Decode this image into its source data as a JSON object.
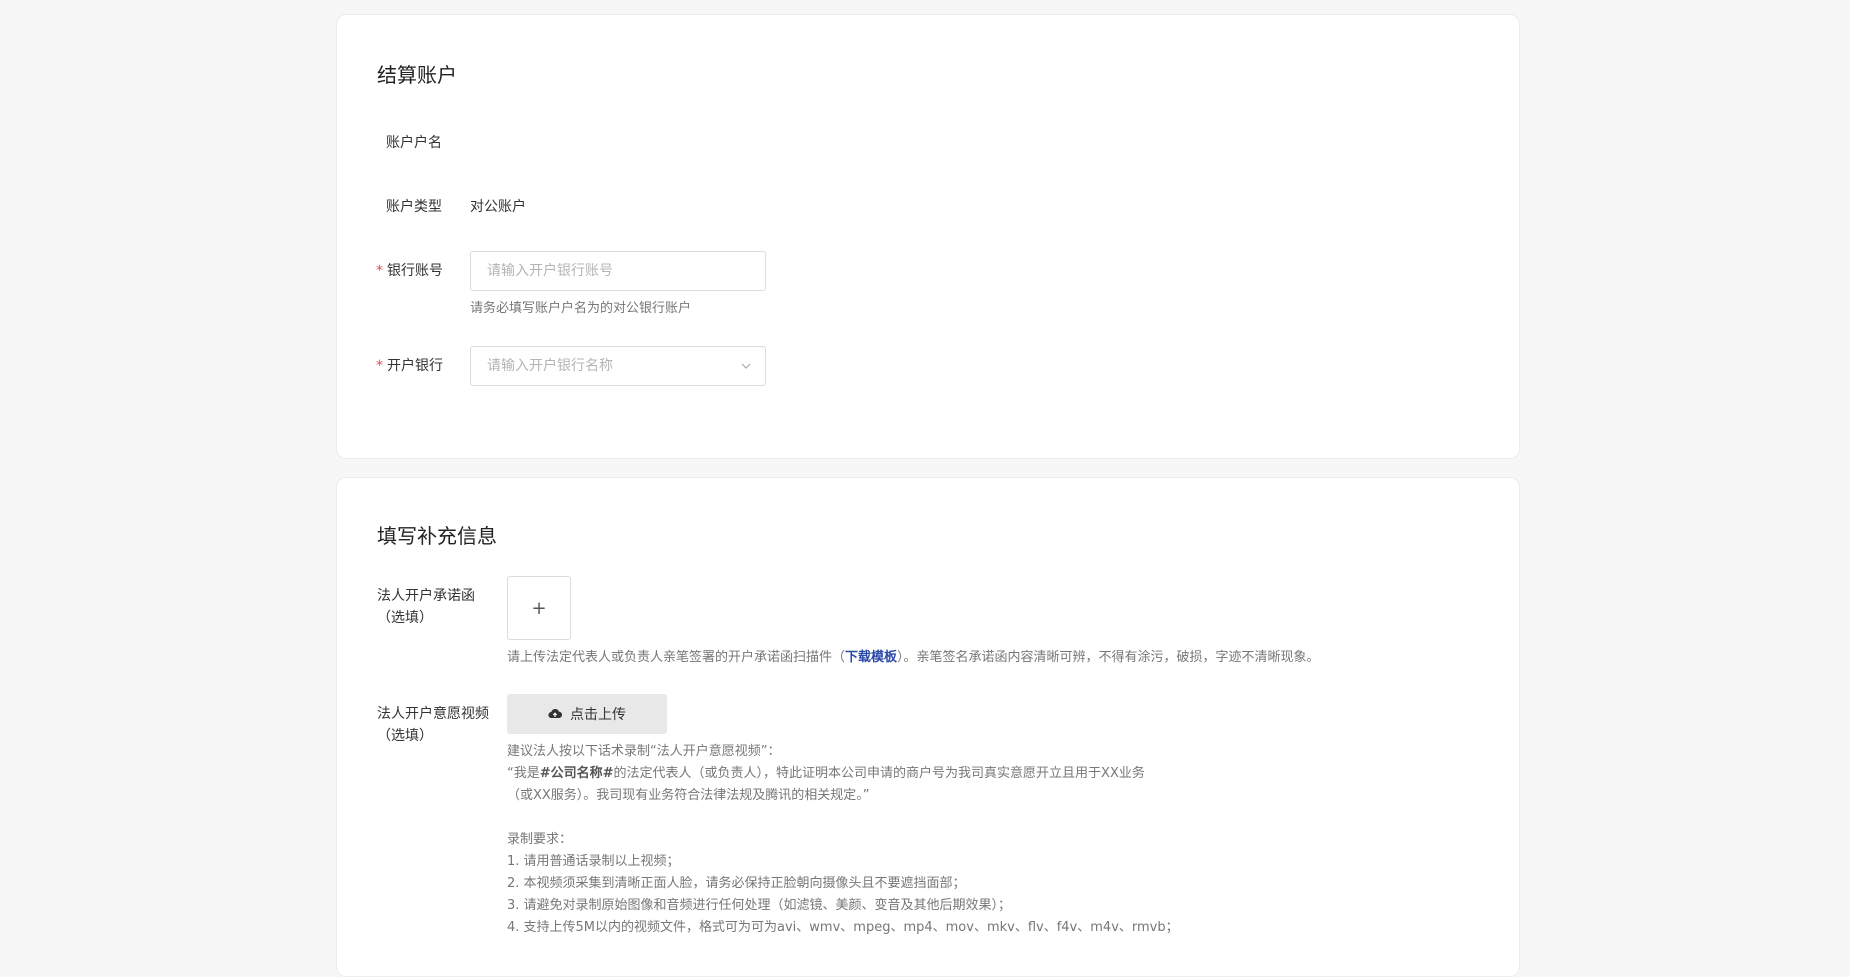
{
  "settlement": {
    "title": "结算账户",
    "account_name_label": "账户户名",
    "account_name_value": "",
    "account_type_label": "账户类型",
    "account_type_value": "对公账户",
    "bank_account_label": "银行账号",
    "bank_account_placeholder": "请输入开户银行账号",
    "bank_account_hint": "请务必填写账户户名为的对公银行账户",
    "bank_label": "开户银行",
    "bank_placeholder": "请输入开户银行名称",
    "required_mark": "*"
  },
  "supplement": {
    "title": "填写补充信息",
    "letter_label_line1": "法人开户承诺函",
    "letter_label_line2": "（选填）",
    "letter_hint_before": "请上传法定代表人或负责人亲笔签署的开户承诺函扫描件（",
    "letter_hint_link": "下载模板",
    "letter_hint_after": "）。亲笔签名承诺函内容清晰可辨，不得有涂污，破损，字迹不清晰现象。",
    "plus_glyph": "+",
    "video_label_line1": "法人开户意愿视频",
    "video_label_line2": "（选填）",
    "upload_button_label": "点击上传",
    "video_intro": "建议法人按以下话术录制“法人开户意愿视频”：",
    "script_prefix": "“我是",
    "script_bold": "#公司名称#",
    "script_suffix": "的法定代表人（或负责人），特此证明本公司申请的商户号为我司真实意愿开立且用于XX业务",
    "script_line2": "（或XX服务）。我司现有业务符合法律法规及腾讯的相关规定。”",
    "req_title": "录制要求：",
    "req_1": "1. 请用普通话录制以上视频；",
    "req_2": "2. 本视频须采集到清晰正面人脸，请务必保持正脸朝向摄像头且不要遮挡面部；",
    "req_3": "3. 请避免对录制原始图像和音频进行任何处理（如滤镜、美颜、变音及其他后期效果）；",
    "req_4": "4. 支持上传5M以内的视频文件，格式可为可为avi、wmv、mpeg、mp4、mov、mkv、flv、f4v、m4v、rmvb；"
  }
}
